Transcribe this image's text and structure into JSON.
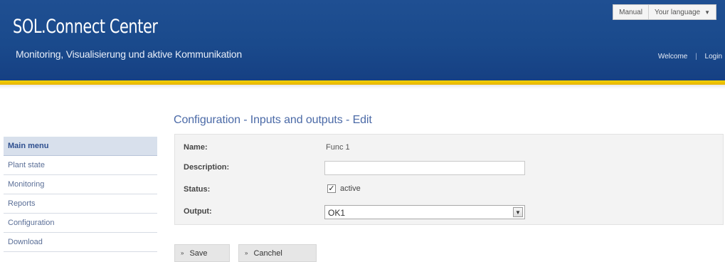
{
  "header": {
    "brand": "SOL.Connect Center",
    "tagline": "Monitoring, Visualisierung und aktive Kommunikation",
    "welcome": "Welcome",
    "login": "Login",
    "manual": "Manual",
    "language": "Your language"
  },
  "page": {
    "title": "Configuration - Inputs and outputs - Edit"
  },
  "sidebar": {
    "items": [
      {
        "label": "Main menu"
      },
      {
        "label": "Plant state"
      },
      {
        "label": "Monitoring"
      },
      {
        "label": "Reports"
      },
      {
        "label": "Configuration"
      },
      {
        "label": "Download"
      }
    ]
  },
  "form": {
    "name_label": "Name:",
    "name_value": "Func 1",
    "description_label": "Description:",
    "description_value": "",
    "status_label": "Status:",
    "status_checkbox": "active",
    "status_checked": true,
    "output_label": "Output:",
    "output_value": "OK1"
  },
  "buttons": {
    "save": "Save",
    "cancel": "Canchel"
  },
  "colors": {
    "header_blue": "#1a4a8c",
    "accent_yellow": "#f2d200",
    "title_blue": "#4b6aa7"
  }
}
